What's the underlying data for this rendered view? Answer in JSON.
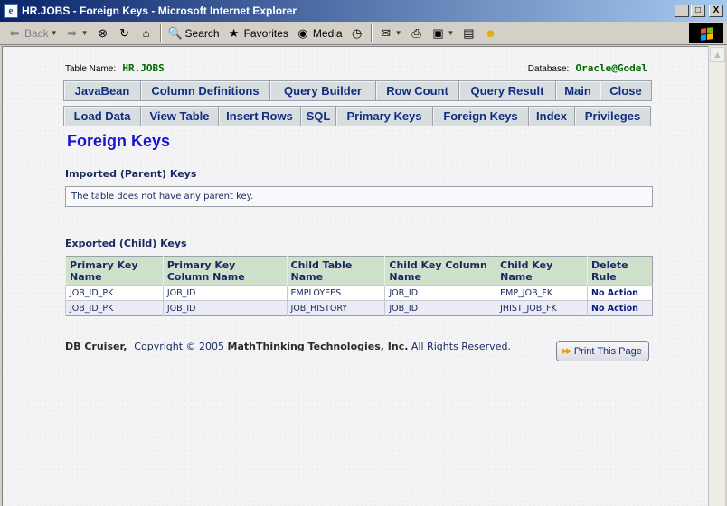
{
  "window": {
    "title": "HR.JOBS - Foreign Keys - Microsoft Internet Explorer",
    "minimize": "_",
    "maximize": "□",
    "close": "X"
  },
  "toolbar": {
    "back": "Back",
    "search": "Search",
    "favorites": "Favorites",
    "media": "Media"
  },
  "meta": {
    "table_label": "Table Name:",
    "table_value": "HR.JOBS",
    "db_label": "Database:",
    "db_value": "Oracle@Godel"
  },
  "nav_row1": [
    "JavaBean",
    "Column Definitions",
    "Query Builder",
    "Row Count",
    "Query Result",
    "Main",
    "Close"
  ],
  "nav_row2": [
    "Load Data",
    "View Table",
    "Insert Rows",
    "SQL",
    "Primary Keys",
    "Foreign Keys",
    "Index",
    "Privileges"
  ],
  "page_title": "Foreign Keys",
  "imported": {
    "heading": "Imported (Parent) Keys",
    "message": "The table does not have any parent key."
  },
  "exported": {
    "heading": "Exported (Child) Keys",
    "columns": [
      [
        "Primary Key",
        "Name"
      ],
      [
        "Primary Key",
        "Column Name"
      ],
      [
        "Child Table",
        "Name"
      ],
      [
        "Child Key Column",
        "Name"
      ],
      [
        "Child Key",
        "Name"
      ],
      [
        "Delete",
        "Rule"
      ]
    ],
    "rows": [
      [
        "JOB_ID_PK",
        "JOB_ID",
        "EMPLOYEES",
        "JOB_ID",
        "EMP_JOB_FK",
        "No Action"
      ],
      [
        "JOB_ID_PK",
        "JOB_ID",
        "JOB_HISTORY",
        "JOB_ID",
        "JHIST_JOB_FK",
        "No Action"
      ]
    ]
  },
  "footer": {
    "product": "DB Cruiser,",
    "copyright": "Copyright © 2005",
    "company": "MathThinking Technologies, Inc.",
    "rights": "All Rights Reserved.",
    "print_label": "Print This Page"
  },
  "colors": {
    "title_blue": "#1a14d0",
    "nav_text": "#102e80",
    "meta_green": "#006600",
    "header_green": "#cfe0cd"
  }
}
